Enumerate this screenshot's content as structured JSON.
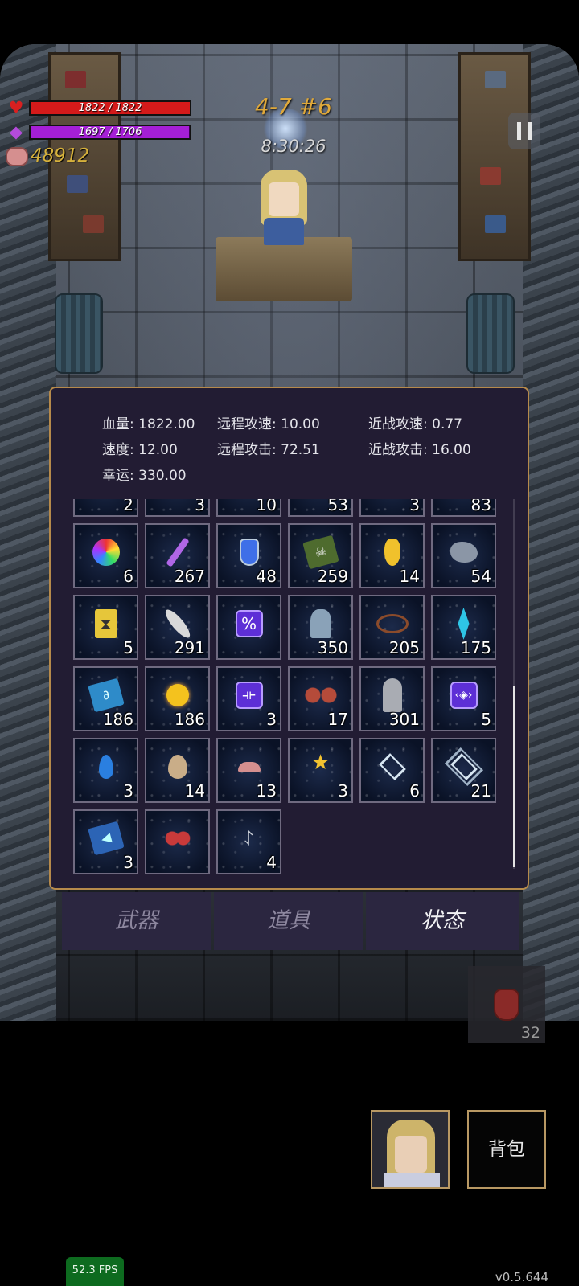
{
  "hud": {
    "hp_text": "1822 / 1822",
    "hp_fraction": 1.0,
    "mp_text": "1697 / 1706",
    "mp_fraction": 0.995,
    "gold": "48912",
    "stage": "4-7 #6",
    "timer": "8:30:26",
    "colors": {
      "hp": "#d41a1a",
      "mp": "#a51fd6",
      "gold": "#d6b13c",
      "stage": "#e0a93a"
    }
  },
  "stats": {
    "hp_label": "血量:",
    "hp_value": "1822.00",
    "ranged_speed_label": "远程攻速:",
    "ranged_speed_value": "10.00",
    "melee_speed_label": "近战攻速:",
    "melee_speed_value": "0.77",
    "speed_label": "速度:",
    "speed_value": "12.00",
    "ranged_atk_label": "远程攻击:",
    "ranged_atk_value": "72.51",
    "melee_atk_label": "近战攻击:",
    "melee_atk_value": "16.00",
    "luck_label": "幸运:",
    "luck_value": "330.00"
  },
  "inventory": {
    "partial_row": [
      "2",
      "3",
      "10",
      "53",
      "3",
      "83"
    ],
    "rows": [
      [
        {
          "icon": "rainbow-orb-icon",
          "qty": "6"
        },
        {
          "icon": "purple-wand-icon",
          "qty": "267"
        },
        {
          "icon": "blue-potion-icon",
          "qty": "48"
        },
        {
          "icon": "skull-book-icon",
          "qty": "259"
        },
        {
          "icon": "yellow-crystal-icon",
          "qty": "14"
        },
        {
          "icon": "grey-rock-icon",
          "qty": "54"
        }
      ],
      [
        {
          "icon": "hourglass-card-icon",
          "qty": "5"
        },
        {
          "icon": "feather-icon",
          "qty": "291"
        },
        {
          "icon": "percent-rune-icon",
          "qty": ""
        },
        {
          "icon": "axe-icon",
          "qty": "350"
        },
        {
          "icon": "thorn-crown-icon",
          "qty": "205"
        },
        {
          "icon": "blue-crystal-icon",
          "qty": "175"
        }
      ],
      [
        {
          "icon": "blue-book-icon",
          "qty": "186"
        },
        {
          "icon": "gold-coin-icon",
          "qty": "186"
        },
        {
          "icon": "split-rune-icon",
          "qty": "3"
        },
        {
          "icon": "red-gloves-icon",
          "qty": "17"
        },
        {
          "icon": "robe-statue-icon",
          "qty": "301"
        },
        {
          "icon": "eye-rune-icon",
          "qty": "5"
        }
      ],
      [
        {
          "icon": "water-drop-icon",
          "qty": "3"
        },
        {
          "icon": "egg-icon",
          "qty": "14"
        },
        {
          "icon": "mushroom-icon",
          "qty": "13"
        },
        {
          "icon": "star-trophy-icon",
          "qty": "3"
        },
        {
          "icon": "diamond-tile-icon",
          "qty": "6"
        },
        {
          "icon": "stacked-tile-icon",
          "qty": "21"
        }
      ],
      [
        {
          "icon": "triangle-book-icon",
          "qty": "3"
        },
        {
          "icon": "red-flower-icon",
          "qty": ""
        },
        {
          "icon": "hook-arrow-icon",
          "qty": "4"
        }
      ]
    ],
    "scroll_position": 0.5
  },
  "tabs": [
    {
      "label": "武器",
      "active": false
    },
    {
      "label": "道具",
      "active": false
    },
    {
      "label": "状态",
      "active": true
    }
  ],
  "quick_slot": {
    "icon": "red-potion-icon",
    "qty": "32"
  },
  "bag_label": "背包",
  "fps": "52.3 FPS",
  "version": "v0.5.644"
}
